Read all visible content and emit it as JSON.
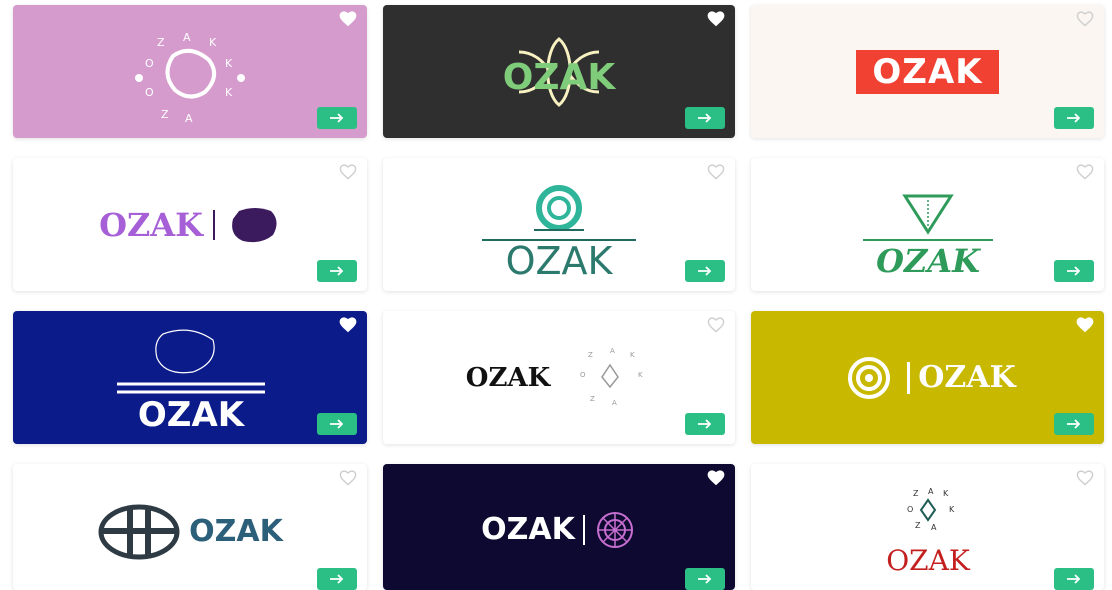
{
  "brand": "OZAK",
  "ring_letters": [
    "O",
    "Z",
    "A",
    "K"
  ],
  "colors": {
    "cta_green": "#2bbf86",
    "heart_white": "#ffffff",
    "heart_outline": "#cfcfcf"
  },
  "icons": {
    "favorite": "heart-icon",
    "open": "arrow-right-icon"
  },
  "cards": [
    {
      "id": "c1",
      "bg": "#d59bcd",
      "favorited": true
    },
    {
      "id": "c2",
      "bg": "#2f2f2f",
      "favorited": true
    },
    {
      "id": "c3",
      "bg": "#fbf6f1",
      "favorited": false
    },
    {
      "id": "c4",
      "bg": "#ffffff",
      "favorited": false
    },
    {
      "id": "c5",
      "bg": "#ffffff",
      "favorited": false
    },
    {
      "id": "c6",
      "bg": "#ffffff",
      "favorited": false
    },
    {
      "id": "c7",
      "bg": "#0b1b8a",
      "favorited": true
    },
    {
      "id": "c8",
      "bg": "#ffffff",
      "favorited": false
    },
    {
      "id": "c9",
      "bg": "#c9b800",
      "favorited": true
    },
    {
      "id": "c10",
      "bg": "#ffffff",
      "favorited": false
    },
    {
      "id": "c11",
      "bg": "#0d0930",
      "favorited": true
    },
    {
      "id": "c12",
      "bg": "#ffffff",
      "favorited": false
    }
  ]
}
